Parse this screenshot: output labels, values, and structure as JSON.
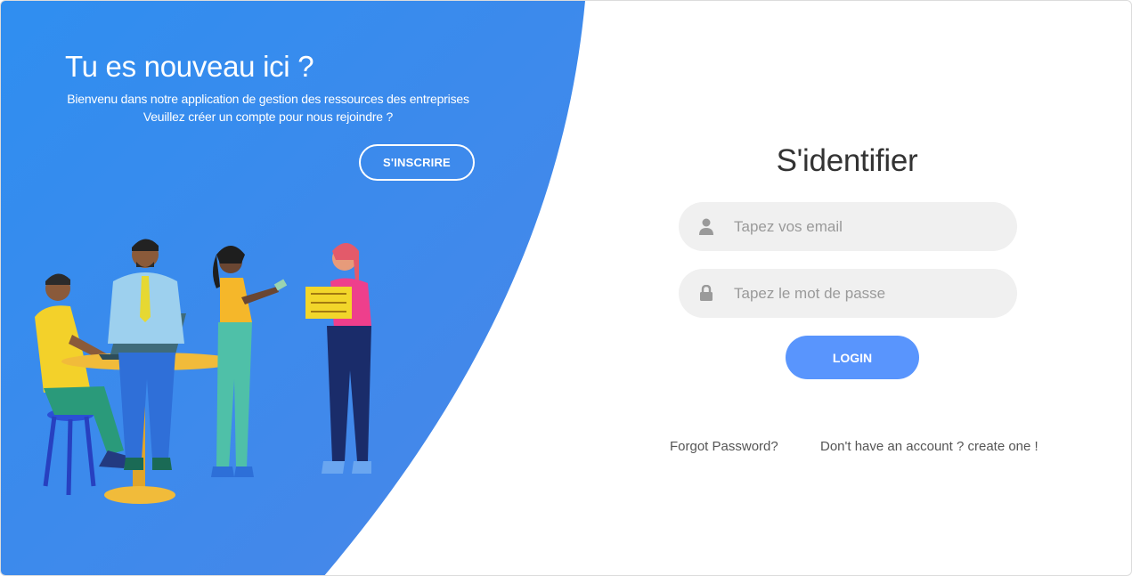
{
  "left_panel": {
    "title": "Tu es nouveau ici ?",
    "description": "Bienvenu dans notre application de gestion des ressources des entreprises Veuillez créer un compte pour nous rejoindre ?",
    "signup_label": "S'INSCRIRE",
    "gradient_start": "#2f8ef0",
    "gradient_end": "#4a86e8"
  },
  "login_form": {
    "title": "S'identifier",
    "email_placeholder": "Tapez vos email",
    "email_value": "",
    "email_icon": "user-icon",
    "password_placeholder": "Tapez le mot de passe",
    "password_value": "",
    "password_icon": "lock-icon",
    "login_label": "LOGIN",
    "accent": "#5995fd"
  },
  "links": {
    "forgot": "Forgot Password?",
    "create": "Don't have an account ? create one !"
  }
}
